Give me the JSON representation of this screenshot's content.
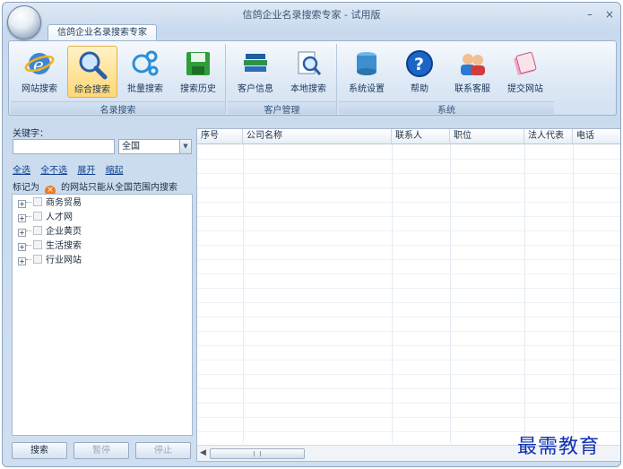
{
  "window": {
    "title": "信鸽企业名录搜索专家 - 试用版",
    "minimize": "–",
    "close": "×"
  },
  "ribbon": {
    "tab": "信鸽企业名录搜索专家",
    "groups": [
      {
        "label": "名录搜索",
        "buttons": [
          "网站搜索",
          "综合搜索",
          "批量搜索",
          "搜索历史"
        ]
      },
      {
        "label": "客户管理",
        "buttons": [
          "客户信息",
          "本地搜索"
        ]
      },
      {
        "label": "系统",
        "buttons": [
          "系统设置",
          "帮助",
          "联系客服",
          "提交网站"
        ]
      }
    ],
    "active_button": "综合搜索"
  },
  "search": {
    "keyword_label": "关键字：",
    "keyword_value": "",
    "region_value": "全国",
    "links": [
      "全选",
      "全不选",
      "展开",
      "缩起"
    ],
    "note_prefix": "标记为",
    "note_suffix": "的网站只能从全国范围内搜索",
    "tree": [
      "商务贸易",
      "人才网",
      "企业黄页",
      "生活搜索",
      "行业网站"
    ],
    "buttons": {
      "search": "搜索",
      "pause": "暂停",
      "stop": "停止"
    }
  },
  "table": {
    "columns": [
      "序号",
      "公司名称",
      "联系人",
      "职位",
      "法人代表",
      "电话"
    ],
    "rows": []
  },
  "watermark": "最需教育",
  "colors": {
    "accent": "#1f3b5c",
    "active_button": "#ffd776",
    "watermark": "#1030b0"
  }
}
